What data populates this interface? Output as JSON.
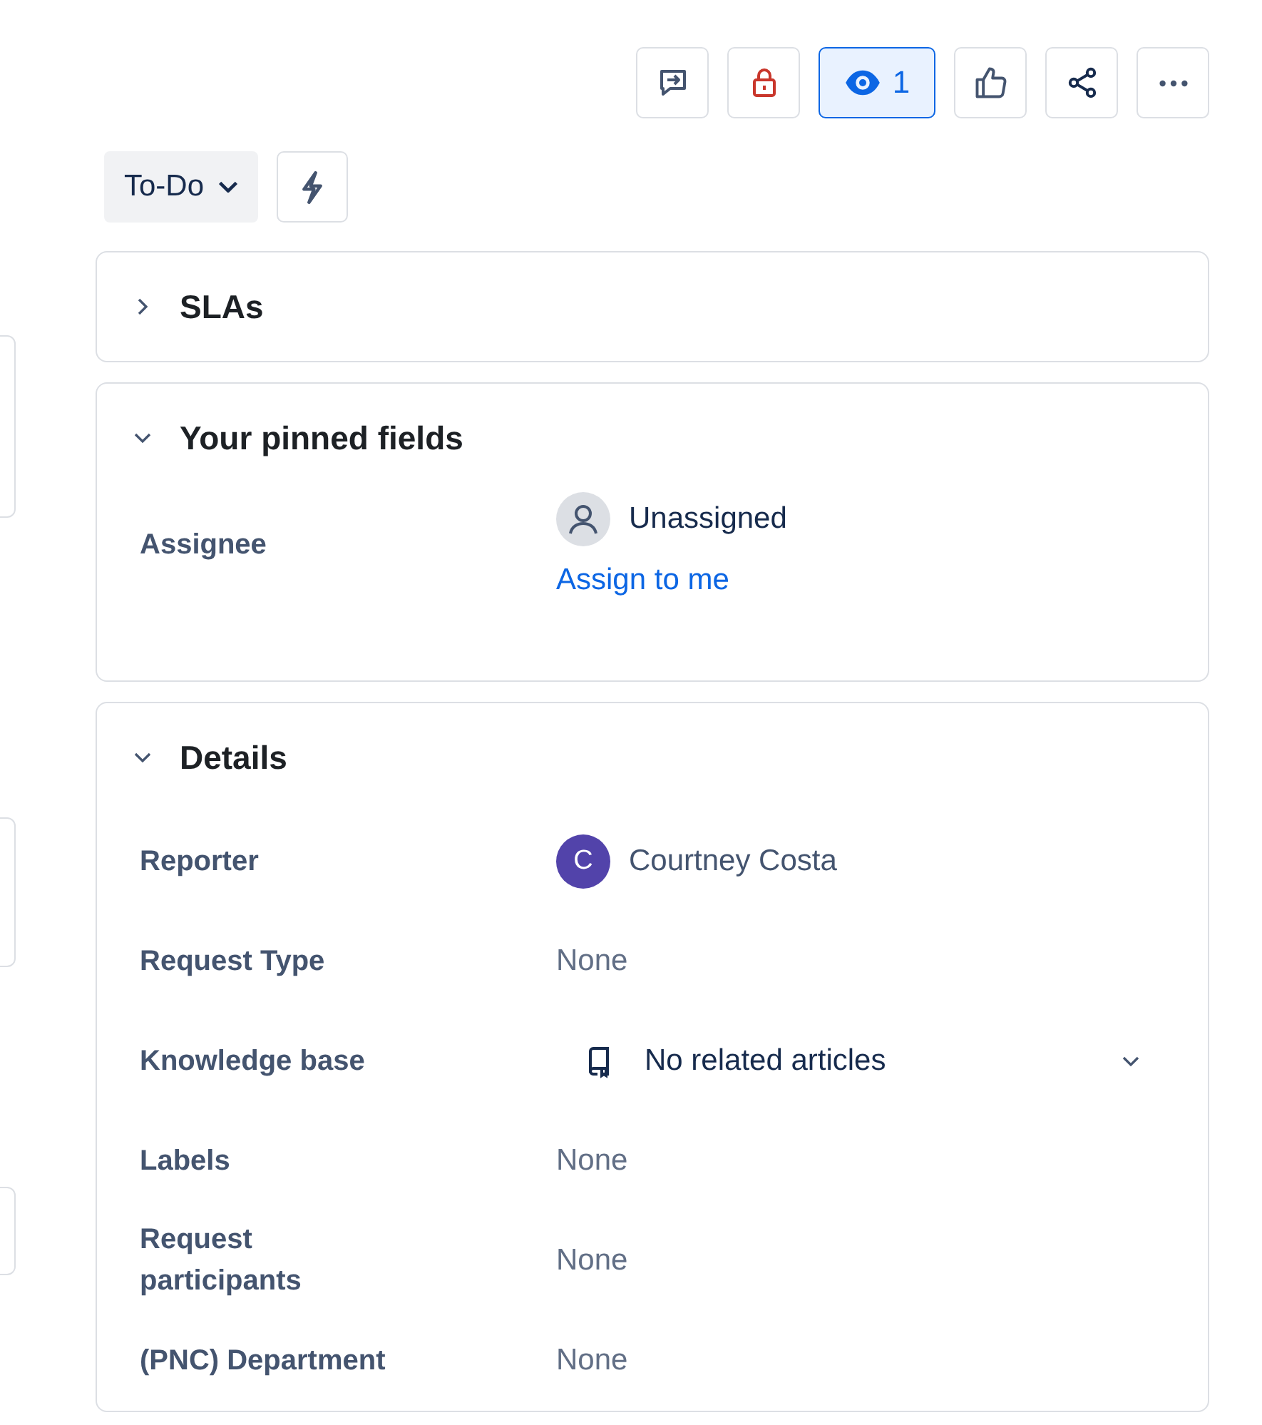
{
  "toolbar": [
    {
      "kind": "feedback",
      "selected": false
    },
    {
      "kind": "lock",
      "selected": false
    },
    {
      "kind": "watch",
      "label": "1",
      "selected": true
    },
    {
      "kind": "like",
      "selected": false
    },
    {
      "kind": "share",
      "selected": false
    },
    {
      "kind": "more",
      "selected": false
    }
  ],
  "status": {
    "label": "To-Do"
  },
  "sections": [
    {
      "title": "SLAs",
      "expanded": false
    },
    {
      "title": "Your pinned fields",
      "expanded": true,
      "fields": [
        {
          "kind": "assignee",
          "label": "Assignee",
          "value": "Unassigned",
          "link": "Assign to me"
        }
      ]
    },
    {
      "title": "Details",
      "expanded": true,
      "fields": [
        {
          "kind": "user",
          "label": "Reporter",
          "value": "Courtney Costa",
          "initial": "C",
          "color": "#5243aa"
        },
        {
          "kind": "text",
          "label": "Request Type",
          "value": "None"
        },
        {
          "kind": "select",
          "label": "Knowledge base",
          "value": "No related articles"
        },
        {
          "kind": "text",
          "label": "Labels",
          "value": "None"
        },
        {
          "kind": "text",
          "label": "Request participants",
          "value": "None"
        },
        {
          "kind": "text",
          "label": "(PNC) Department",
          "value": "None"
        }
      ]
    }
  ]
}
